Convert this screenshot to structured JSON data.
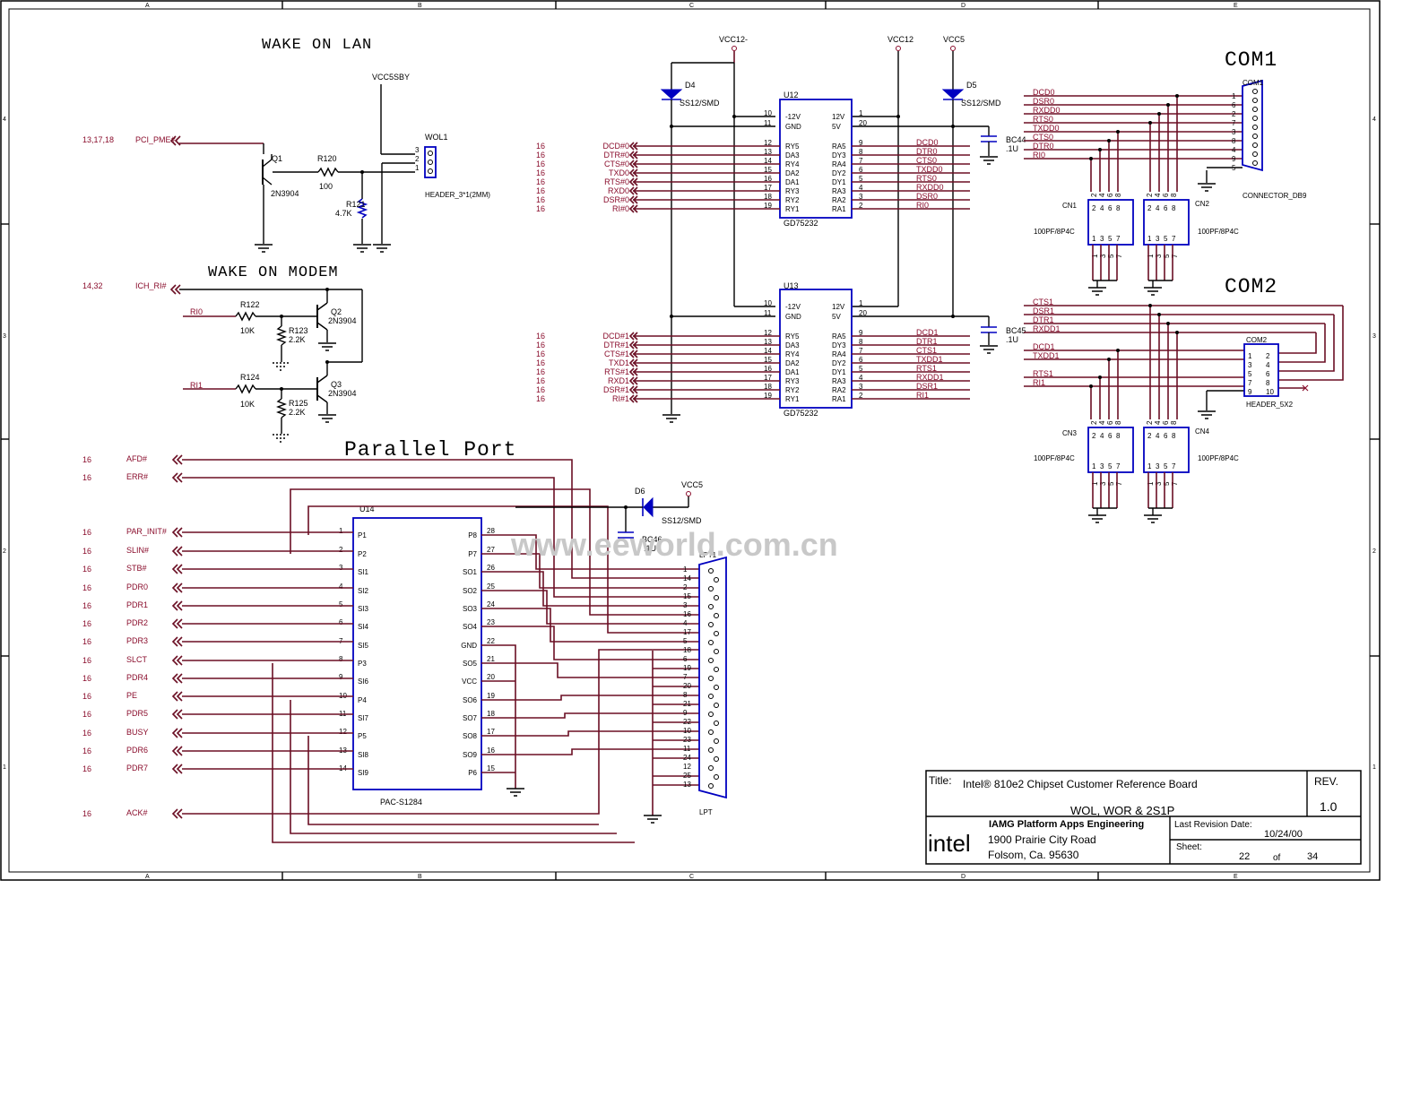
{
  "titles": {
    "wake_on_lan": "WAKE ON LAN",
    "wake_on_modem": "WAKE ON MODEM",
    "parallel_port": "Parallel Port",
    "com1": "COM1",
    "com2": "COM2"
  },
  "watermark": "www.eeworld.com.cn",
  "grid": {
    "columns": [
      "A",
      "B",
      "C",
      "D",
      "E"
    ],
    "rows": [
      "4",
      "3",
      "2",
      "1"
    ]
  },
  "wol": {
    "vcc": "VCC5SBY",
    "sheet_ref": "13,17,18",
    "net": "PCI_PME#",
    "transistor": "Q1",
    "transistor_part": "2N3904",
    "resistor": "R120",
    "resistor_value": "100",
    "pulldown": "R121",
    "pulldown_value": "4.7K",
    "header": "WOL1",
    "header_pins": [
      "3",
      "2",
      "1"
    ],
    "header_part": "HEADER_3*1(2MM)"
  },
  "wom": {
    "sheet_ref": "14,32",
    "net": "ICH_RI#",
    "in_a": "RI0",
    "in_b": "RI1",
    "ra": "R122",
    "ra_value": "10K",
    "rb": "R123",
    "rb_value": "2.2K",
    "rc": "R124",
    "rc_value": "10K",
    "rd": "R125",
    "rd_value": "2.2K",
    "qa": "Q2",
    "qa_part": "2N3904",
    "qb": "Q3",
    "qb_part": "2N3904"
  },
  "power": {
    "vcc12n": "VCC12-",
    "vcc12": "VCC12",
    "vcc5_top": "VCC5",
    "vcc5_lpt": "VCC5",
    "d4": "D4",
    "d5": "D5",
    "d6": "D6",
    "diode_part": "SS12/SMD",
    "bc44": "BC44",
    "bc45": "BC45",
    "bc46": "BC46",
    "cap_value": ".1U"
  },
  "u12": {
    "ref": "U12",
    "part": "GD75232",
    "left_pins": [
      {
        "num": "10",
        "name": "-12V"
      },
      {
        "num": "11",
        "name": "GND"
      },
      {
        "num": "12",
        "name": "RY5"
      },
      {
        "num": "13",
        "name": "DA3"
      },
      {
        "num": "14",
        "name": "RY4"
      },
      {
        "num": "15",
        "name": "DA2"
      },
      {
        "num": "16",
        "name": "DA1"
      },
      {
        "num": "17",
        "name": "RY3"
      },
      {
        "num": "18",
        "name": "RY2"
      },
      {
        "num": "19",
        "name": "RY1"
      }
    ],
    "right_pins": [
      {
        "num": "1",
        "name": "12V"
      },
      {
        "num": "20",
        "name": "5V"
      },
      {
        "num": "9",
        "name": "RA5"
      },
      {
        "num": "8",
        "name": "DY3"
      },
      {
        "num": "7",
        "name": "RA4"
      },
      {
        "num": "6",
        "name": "DY2"
      },
      {
        "num": "5",
        "name": "DY1"
      },
      {
        "num": "4",
        "name": "RA3"
      },
      {
        "num": "3",
        "name": "RA2"
      },
      {
        "num": "2",
        "name": "RA1"
      }
    ],
    "in_nets": [
      "DCD#0",
      "DTR#0",
      "CTS#0",
      "TXD0",
      "RTS#0",
      "RXD0",
      "DSR#0",
      "RI#0"
    ],
    "in_ref": "16",
    "out_nets": [
      "DCD0",
      "DTR0",
      "CTS0",
      "TXDD0",
      "RTS0",
      "RXDD0",
      "DSR0",
      "RI0"
    ]
  },
  "u13": {
    "ref": "U13",
    "part": "GD75232",
    "left_pins": [
      {
        "num": "10",
        "name": "-12V"
      },
      {
        "num": "11",
        "name": "GND"
      },
      {
        "num": "12",
        "name": "RY5"
      },
      {
        "num": "13",
        "name": "DA3"
      },
      {
        "num": "14",
        "name": "RY4"
      },
      {
        "num": "15",
        "name": "DA2"
      },
      {
        "num": "16",
        "name": "DA1"
      },
      {
        "num": "17",
        "name": "RY3"
      },
      {
        "num": "18",
        "name": "RY2"
      },
      {
        "num": "19",
        "name": "RY1"
      }
    ],
    "right_pins": [
      {
        "num": "1",
        "name": "12V"
      },
      {
        "num": "20",
        "name": "5V"
      },
      {
        "num": "9",
        "name": "RA5"
      },
      {
        "num": "8",
        "name": "DY3"
      },
      {
        "num": "7",
        "name": "RA4"
      },
      {
        "num": "6",
        "name": "DY2"
      },
      {
        "num": "5",
        "name": "DY1"
      },
      {
        "num": "4",
        "name": "RA3"
      },
      {
        "num": "3",
        "name": "RA2"
      },
      {
        "num": "2",
        "name": "RA1"
      }
    ],
    "in_nets": [
      "DCD#1",
      "DTR#1",
      "CTS#1",
      "TXD1",
      "RTS#1",
      "RXD1",
      "DSR#1",
      "RI#1"
    ],
    "in_ref": "16",
    "out_nets": [
      "DCD1",
      "DTR1",
      "CTS1",
      "TXDD1",
      "RTS1",
      "RXDD1",
      "DSR1",
      "RI1"
    ]
  },
  "com1": {
    "ref": "COM1",
    "part": "CONNECTOR_DB9",
    "nets": [
      "DCD0",
      "DSR0",
      "RXDD0",
      "RTS0",
      "TXDD0",
      "CTS0",
      "DTR0",
      "RI0"
    ],
    "pins": [
      "1",
      "6",
      "2",
      "7",
      "3",
      "8",
      "4",
      "9",
      "5"
    ]
  },
  "com2": {
    "ref": "COM2",
    "part": "HEADER_5X2",
    "nets": [
      "CTS1",
      "DSR1",
      "DTR1",
      "RXDD1",
      "DCD1",
      "TXDD1",
      "RTS1",
      "RI1"
    ],
    "pins_left": [
      "1",
      "3",
      "5",
      "7",
      "9"
    ],
    "pins_right": [
      "2",
      "4",
      "6",
      "8",
      "10"
    ]
  },
  "cn": [
    {
      "ref": "CN1",
      "part": "100PF/8P4C"
    },
    {
      "ref": "CN2",
      "part": "100PF/8P4C"
    },
    {
      "ref": "CN3",
      "part": "100PF/8P4C"
    },
    {
      "ref": "CN4",
      "part": "100PF/8P4C"
    }
  ],
  "cn_pins_top": [
    "2",
    "4",
    "6",
    "8"
  ],
  "cn_pins_bot": [
    "1",
    "3",
    "5",
    "7"
  ],
  "lpt_nets": [
    {
      "ref": "16",
      "name": "AFD#"
    },
    {
      "ref": "16",
      "name": "ERR#"
    },
    {
      "ref": "16",
      "name": "PAR_INIT#"
    },
    {
      "ref": "16",
      "name": "SLIN#"
    },
    {
      "ref": "16",
      "name": "STB#"
    },
    {
      "ref": "16",
      "name": "PDR0"
    },
    {
      "ref": "16",
      "name": "PDR1"
    },
    {
      "ref": "16",
      "name": "PDR2"
    },
    {
      "ref": "16",
      "name": "PDR3"
    },
    {
      "ref": "16",
      "name": "SLCT"
    },
    {
      "ref": "16",
      "name": "PDR4"
    },
    {
      "ref": "16",
      "name": "PE"
    },
    {
      "ref": "16",
      "name": "PDR5"
    },
    {
      "ref": "16",
      "name": "BUSY"
    },
    {
      "ref": "16",
      "name": "PDR6"
    },
    {
      "ref": "16",
      "name": "PDR7"
    },
    {
      "ref": "16",
      "name": "ACK#"
    }
  ],
  "u14": {
    "ref": "U14",
    "part": "PAC-S1284",
    "left_pins": [
      {
        "num": "1",
        "name": "P1"
      },
      {
        "num": "2",
        "name": "P2"
      },
      {
        "num": "3",
        "name": "SI1"
      },
      {
        "num": "4",
        "name": "SI2"
      },
      {
        "num": "5",
        "name": "SI3"
      },
      {
        "num": "6",
        "name": "SI4"
      },
      {
        "num": "7",
        "name": "SI5"
      },
      {
        "num": "8",
        "name": "P3"
      },
      {
        "num": "9",
        "name": "SI6"
      },
      {
        "num": "10",
        "name": "P4"
      },
      {
        "num": "11",
        "name": "SI7"
      },
      {
        "num": "12",
        "name": "P5"
      },
      {
        "num": "13",
        "name": "SI8"
      },
      {
        "num": "14",
        "name": "SI9"
      }
    ],
    "right_pins": [
      {
        "num": "28",
        "name": "P8"
      },
      {
        "num": "27",
        "name": "P7"
      },
      {
        "num": "26",
        "name": "SO1"
      },
      {
        "num": "25",
        "name": "SO2"
      },
      {
        "num": "24",
        "name": "SO3"
      },
      {
        "num": "23",
        "name": "SO4"
      },
      {
        "num": "22",
        "name": "GND"
      },
      {
        "num": "21",
        "name": "SO5"
      },
      {
        "num": "20",
        "name": "VCC"
      },
      {
        "num": "19",
        "name": "SO6"
      },
      {
        "num": "18",
        "name": "SO7"
      },
      {
        "num": "17",
        "name": "SO8"
      },
      {
        "num": "16",
        "name": "SO9"
      },
      {
        "num": "15",
        "name": "P6"
      }
    ]
  },
  "lpt": {
    "ref": "LPT1",
    "label": "LPT",
    "pins": [
      "1",
      "14",
      "2",
      "15",
      "3",
      "16",
      "4",
      "17",
      "5",
      "18",
      "6",
      "19",
      "7",
      "20",
      "8",
      "21",
      "9",
      "22",
      "10",
      "23",
      "11",
      "24",
      "12",
      "25",
      "13"
    ]
  },
  "title_block": {
    "title_label": "Title:",
    "title": "Intel® 810e2 Chipset Customer Reference Board",
    "subtitle": "WOL, WOR & 2S1P",
    "rev_label": "REV.",
    "rev": "1.0",
    "logo": "intel",
    "org": "IAMG Platform Apps Engineering",
    "addr1": "1900 Prairie City Road",
    "addr2": "Folsom, Ca. 95630",
    "last_rev_label": "Last Revision Date:",
    "last_rev": "10/24/00",
    "sheet_label": "Sheet:",
    "sheet_num": "22",
    "sheet_of": "of",
    "sheet_total": "34"
  }
}
